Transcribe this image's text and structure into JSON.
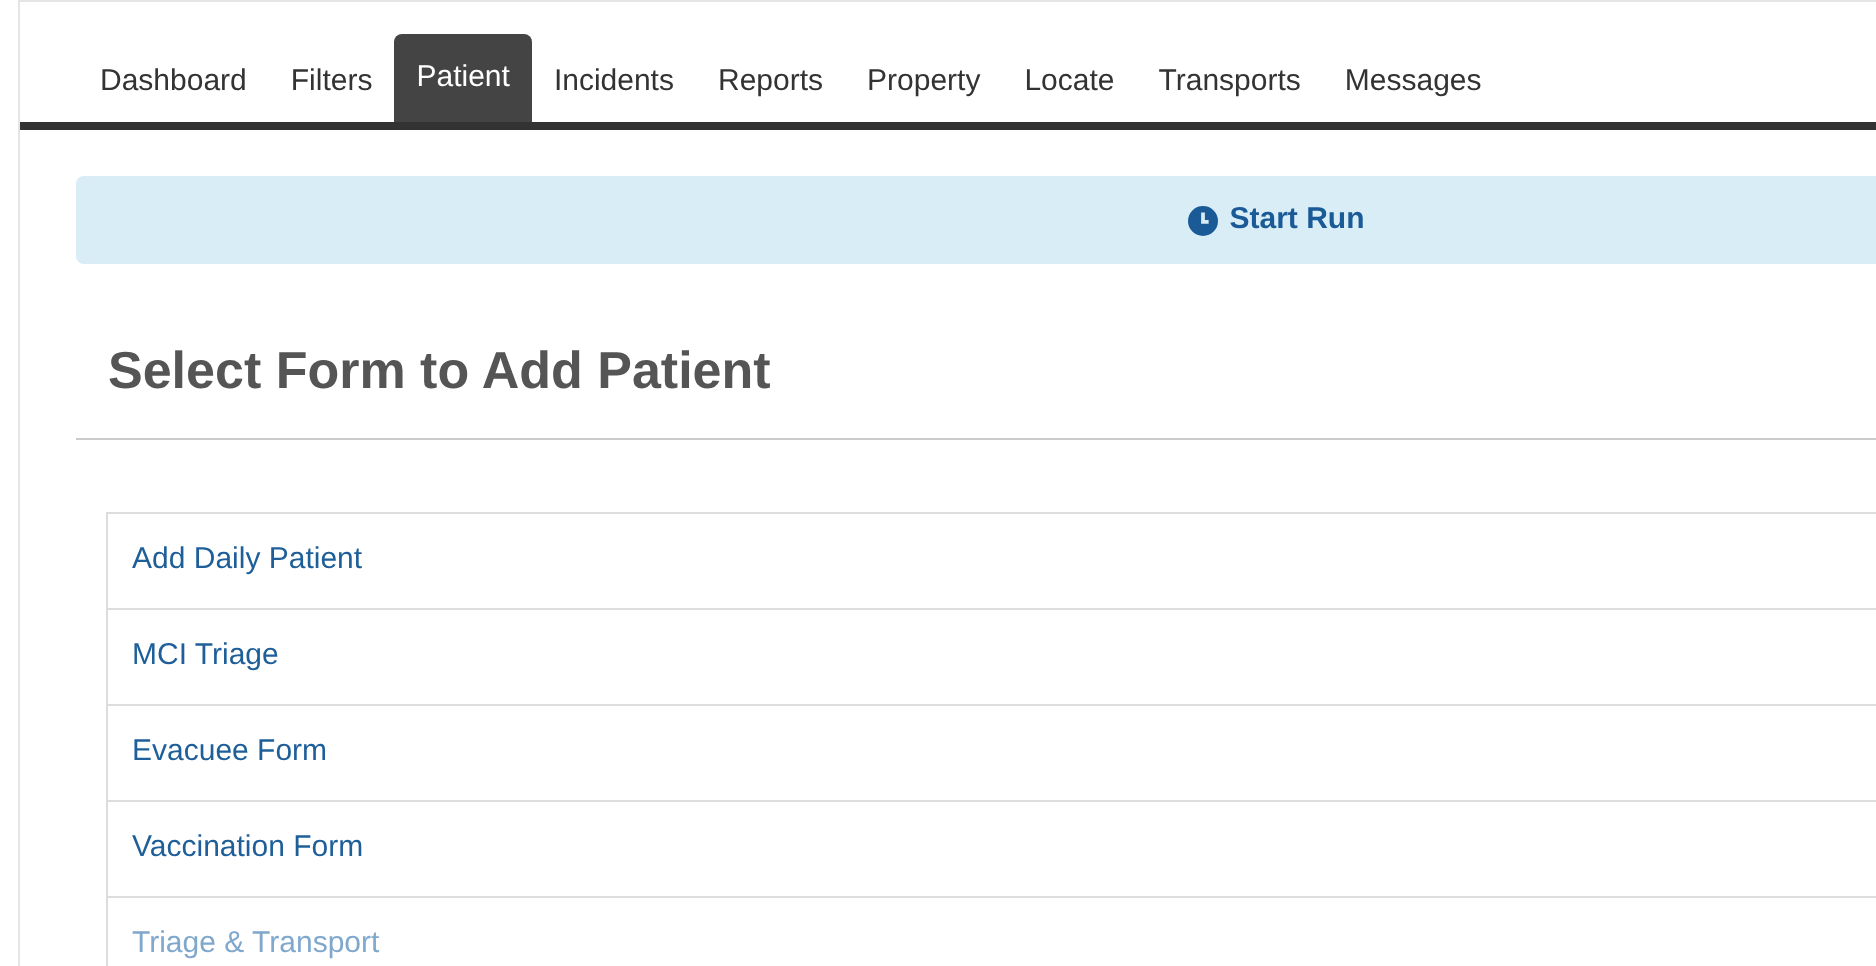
{
  "tabs": [
    {
      "label": "Dashboard",
      "selected": false
    },
    {
      "label": "Filters",
      "selected": false
    },
    {
      "label": "Patient",
      "selected": true
    },
    {
      "label": "Incidents",
      "selected": false
    },
    {
      "label": "Reports",
      "selected": false
    },
    {
      "label": "Property",
      "selected": false
    },
    {
      "label": "Locate",
      "selected": false
    },
    {
      "label": "Transports",
      "selected": false
    },
    {
      "label": "Messages",
      "selected": false
    }
  ],
  "banner": {
    "label": "Start Run"
  },
  "heading": "Select Form to Add Patient",
  "forms": [
    {
      "label": "Add Daily Patient",
      "disabled": false
    },
    {
      "label": "MCI Triage",
      "disabled": false
    },
    {
      "label": "Evacuee Form",
      "disabled": false
    },
    {
      "label": "Vaccination Form",
      "disabled": false
    },
    {
      "label": "Triage & Transport",
      "disabled": true
    }
  ]
}
